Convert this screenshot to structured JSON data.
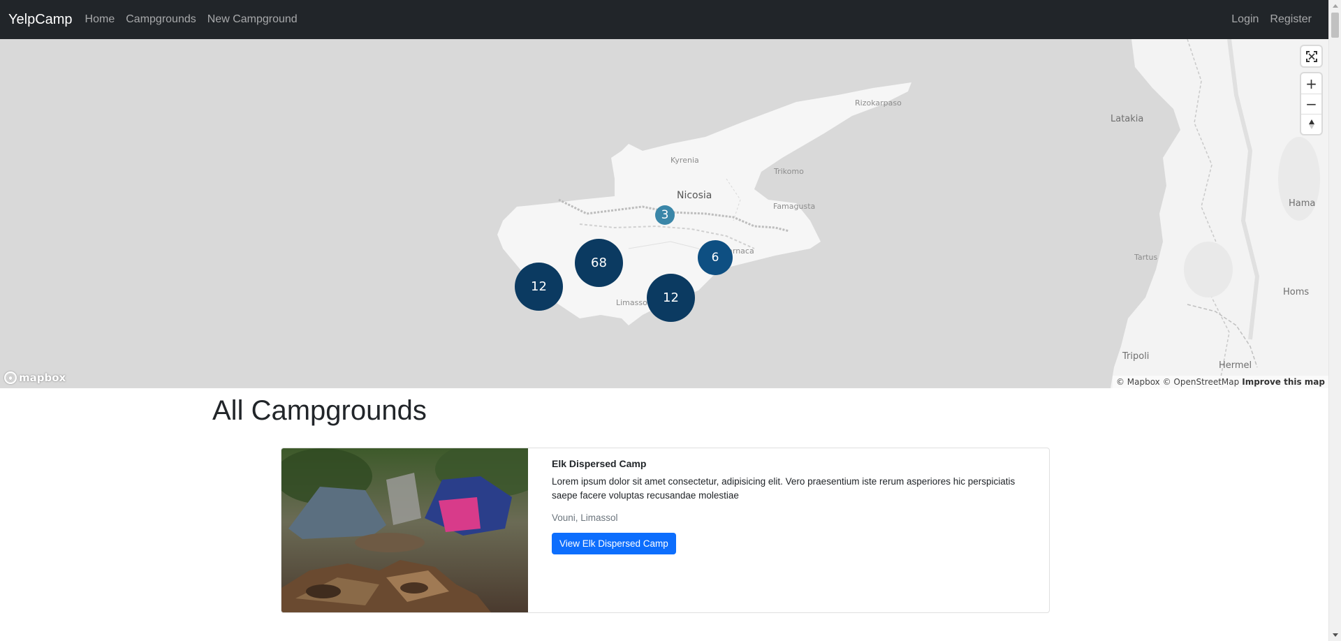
{
  "navbar": {
    "brand": "YelpCamp",
    "links": [
      {
        "label": "Home"
      },
      {
        "label": "Campgrounds"
      },
      {
        "label": "New Campground"
      }
    ],
    "right_links": [
      {
        "label": "Login"
      },
      {
        "label": "Register"
      }
    ]
  },
  "map": {
    "places": {
      "rizokarpaso": "Rizokarpaso",
      "kyrenia": "Kyrenia",
      "trikomo": "Trikomo",
      "nicosia": "Nicosia",
      "famagusta": "Famagusta",
      "larnaca": "Larnaca",
      "limassol": "Limassol",
      "latakia": "Latakia",
      "hama": "Hama",
      "tartus": "Tartus",
      "homs": "Homs",
      "tripoli": "Tripoli",
      "hermel": "Hermel"
    },
    "clusters": [
      {
        "count": "3",
        "color": "#3a86a8"
      },
      {
        "count": "68",
        "color": "#0b3a61"
      },
      {
        "count": "6",
        "color": "#0e4f82"
      },
      {
        "count": "12",
        "color": "#0b3a61"
      },
      {
        "count": "12",
        "color": "#0b3a61"
      }
    ],
    "controls": {
      "fullscreen_icon": "fullscreen-icon",
      "zoom_in": "+",
      "zoom_out": "−",
      "compass_icon": "compass-icon"
    },
    "logo_text": "mapbox",
    "attribution": "© Mapbox © OpenStreetMap",
    "improve_link": "Improve this map"
  },
  "page": {
    "title": "All Campgrounds"
  },
  "campgrounds": [
    {
      "title": "Elk Dispersed Camp",
      "description": "Lorem ipsum dolor sit amet consectetur, adipisicing elit. Vero praesentium iste rerum asperiores hic perspiciatis saepe facere voluptas recusandae molestiae",
      "location": "Vouni, Limassol",
      "button_label": "View Elk Dispersed Camp",
      "button_color": "#0d6efd"
    }
  ]
}
